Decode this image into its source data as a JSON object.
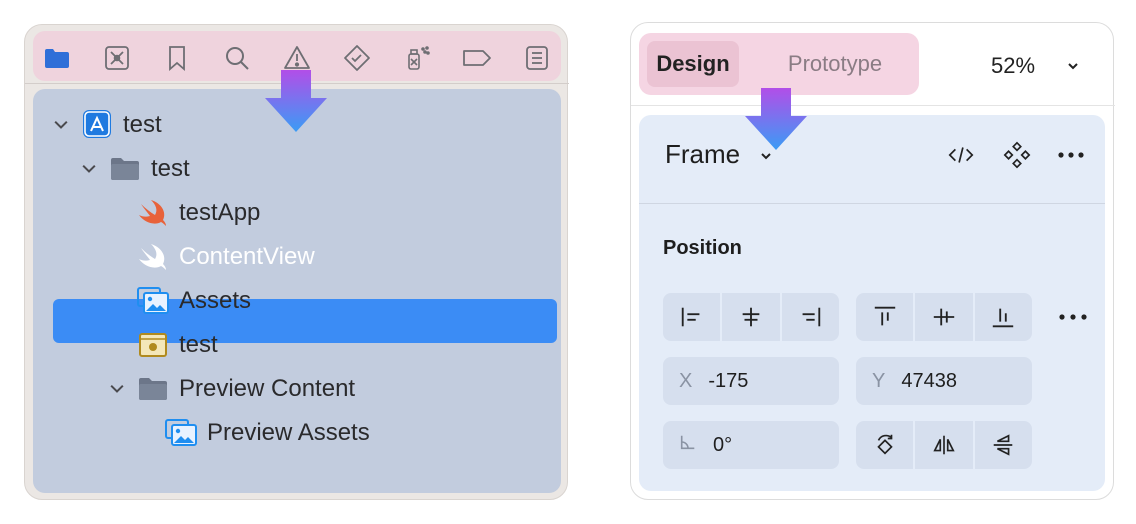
{
  "xcode": {
    "toolbar_icons": [
      "folder-icon",
      "source-control-icon",
      "bookmark-icon",
      "search-icon",
      "warning-icon",
      "test-icon",
      "debug-icon",
      "breakpoint-icon",
      "report-icon"
    ],
    "tree": [
      {
        "label": "test",
        "icon": "app-icon",
        "expanded": true
      },
      {
        "label": "test",
        "icon": "folder-icon",
        "expanded": true
      },
      {
        "label": "testApp",
        "icon": "swift-icon"
      },
      {
        "label": "ContentView",
        "icon": "swift-icon",
        "selected": true
      },
      {
        "label": "Assets",
        "icon": "asset-catalog-icon"
      },
      {
        "label": "test",
        "icon": "entitlements-icon"
      },
      {
        "label": "Preview Content",
        "icon": "folder-icon",
        "expanded": true
      },
      {
        "label": "Preview Assets",
        "icon": "asset-catalog-icon"
      }
    ],
    "colors": {
      "selection": "#3b8cf5",
      "toolbar_highlight": "#efd3dd",
      "tree_bg": "#c2ccde"
    }
  },
  "figma": {
    "tabs": {
      "design": "Design",
      "prototype": "Prototype"
    },
    "zoom": "52%",
    "frame": {
      "title": "Frame"
    },
    "position": {
      "label": "Position",
      "x_label": "X",
      "x_value": "-175",
      "y_label": "Y",
      "y_value": "47438",
      "rotation_value": "0°"
    },
    "colors": {
      "tab_highlight": "#f5d5e3",
      "panel_bg": "#e4ecf8",
      "field_bg": "#d6dfee"
    }
  }
}
